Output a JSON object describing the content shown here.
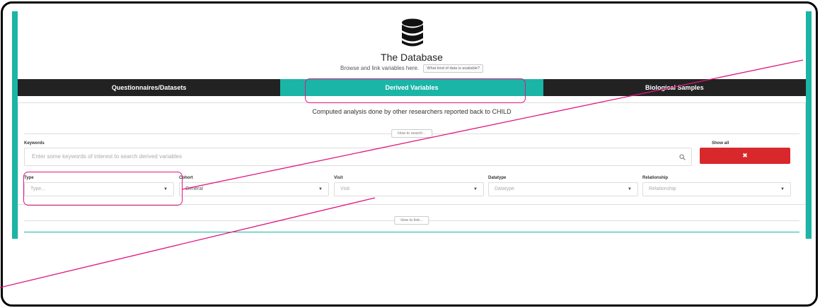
{
  "header": {
    "icon": "database-icon",
    "title": "The Database",
    "subtitle": "Browse and link variables here.",
    "help_button": "What kind of data is available?"
  },
  "tabs": [
    {
      "label": "Questionnaires/Datasets",
      "active": false
    },
    {
      "label": "Derived Variables",
      "active": true
    },
    {
      "label": "Biological Samples",
      "active": false
    }
  ],
  "panel": {
    "description": "Computed analysis done by other researchers reported back to CHILD",
    "how_to_search": "How to search...",
    "keywords_label": "Keywords",
    "search_placeholder": "Enter some keywords of interest to search derived variables",
    "show_all_label": "Show all",
    "clear_icon": "✖",
    "filters": [
      {
        "label": "Type",
        "value": "",
        "placeholder": "Type..."
      },
      {
        "label": "Cohort",
        "value": "General",
        "placeholder": ""
      },
      {
        "label": "Visit",
        "value": "",
        "placeholder": "Visit"
      },
      {
        "label": "Datatype",
        "value": "",
        "placeholder": "Datatype"
      },
      {
        "label": "Relationship",
        "value": "",
        "placeholder": "Relationship"
      }
    ],
    "how_to_link": "How to link..."
  },
  "colors": {
    "accent": "#1bb5a7",
    "dark_tab": "#222222",
    "danger": "#d9282b",
    "annotation": "#e0157f"
  }
}
